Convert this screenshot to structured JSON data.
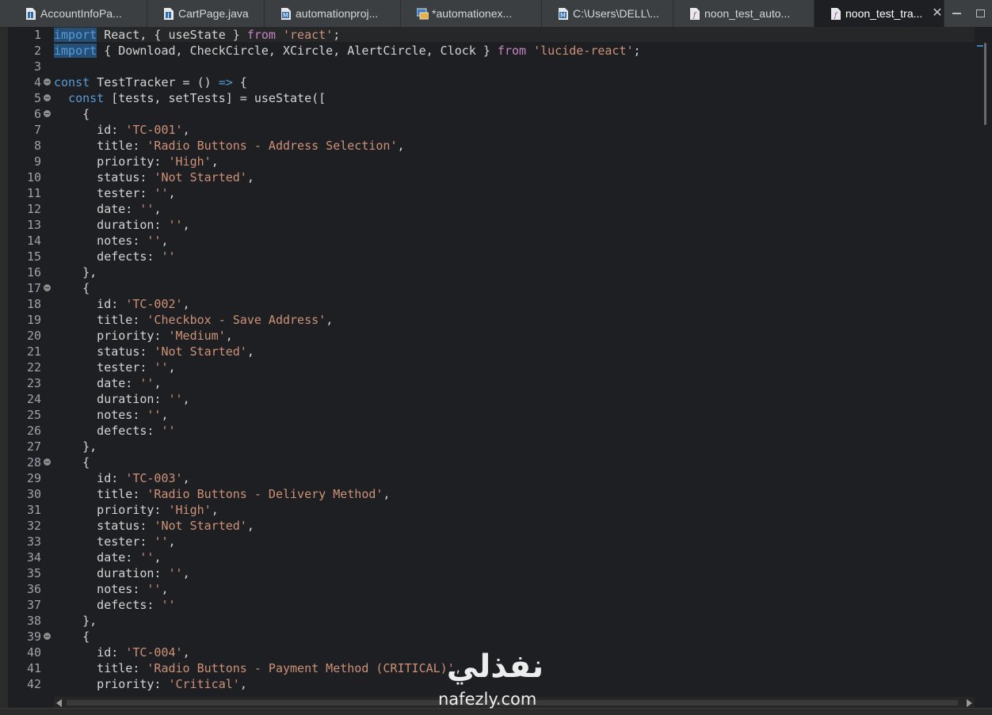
{
  "tabs": [
    {
      "label": "AccountInfoPa...",
      "icon": "java-file-icon",
      "active": false
    },
    {
      "label": "CartPage.java",
      "icon": "java-file-icon",
      "active": false
    },
    {
      "label": "automationproj...",
      "icon": "maven-pom-icon",
      "active": false
    },
    {
      "label": "*automationex...",
      "icon": "project-settings-icon",
      "active": false
    },
    {
      "label": "C:\\Users\\DELL\\...",
      "icon": "maven-pom-icon",
      "active": false
    },
    {
      "label": "noon_test_auto...",
      "icon": "jsx-file-icon",
      "active": false
    },
    {
      "label": "noon_test_tra...",
      "icon": "jsx-file-icon",
      "active": true
    }
  ],
  "colors": {
    "keyword": "#c586c0",
    "keyword_selected": "#569cd6",
    "selection": "#264f78",
    "string": "#ce9178",
    "text": "#d4d4d4",
    "editor_bg": "#1e1f22",
    "tabbar_bg": "#3c3f41"
  },
  "editor": {
    "line_numbers": [
      "1",
      "2",
      "3",
      "4",
      "5",
      "6",
      "7",
      "8",
      "9",
      "10",
      "11",
      "12",
      "13",
      "14",
      "15",
      "16",
      "17",
      "18",
      "19",
      "20",
      "21",
      "22",
      "23",
      "24",
      "25",
      "26",
      "27",
      "28",
      "29",
      "30",
      "31",
      "32",
      "33",
      "34",
      "35",
      "36",
      "37",
      "38",
      "39",
      "40",
      "41",
      "42"
    ],
    "fold_lines": [
      "4",
      "5",
      "6",
      "17",
      "28",
      "39"
    ],
    "lines": [
      "import React, { useState } from 'react';",
      "import { Download, CheckCircle, XCircle, AlertCircle, Clock } from 'lucide-react';",
      "",
      "const TestTracker = () => {",
      "  const [tests, setTests] = useState([",
      "    {",
      "      id: 'TC-001',",
      "      title: 'Radio Buttons - Address Selection',",
      "      priority: 'High',",
      "      status: 'Not Started',",
      "      tester: '',",
      "      date: '',",
      "      duration: '',",
      "      notes: '',",
      "      defects: ''",
      "    },",
      "    {",
      "      id: 'TC-002',",
      "      title: 'Checkbox - Save Address',",
      "      priority: 'Medium',",
      "      status: 'Not Started',",
      "      tester: '',",
      "      date: '',",
      "      duration: '',",
      "      notes: '',",
      "      defects: ''",
      "    },",
      "    {",
      "      id: 'TC-003',",
      "      title: 'Radio Buttons - Delivery Method',",
      "      priority: 'High',",
      "      status: 'Not Started',",
      "      tester: '',",
      "      date: '',",
      "      duration: '',",
      "      notes: '',",
      "      defects: ''",
      "    },",
      "    {",
      "      id: 'TC-004',",
      "      title: 'Radio Buttons - Payment Method (CRITICAL)',",
      "      priority: 'Critical',"
    ]
  },
  "watermark": {
    "brand_ar": "نفذلي",
    "brand_en": "nafezly.com"
  }
}
